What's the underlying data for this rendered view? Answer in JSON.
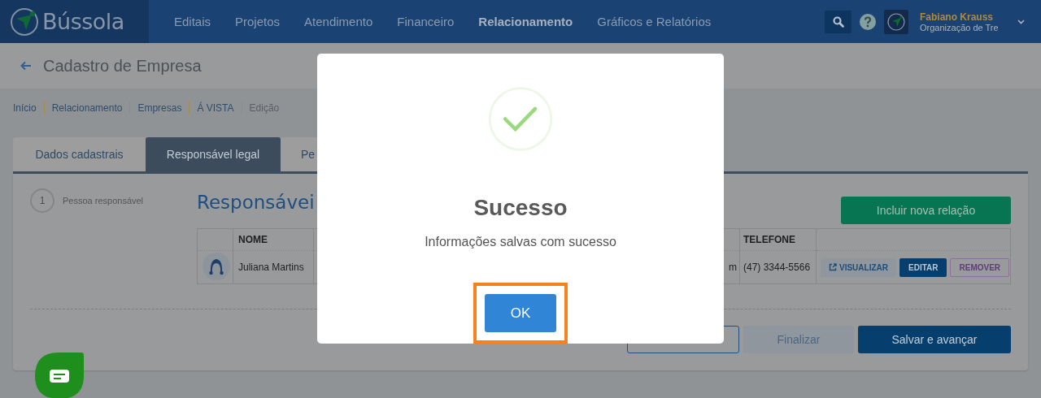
{
  "header": {
    "logo": "Bússola",
    "nav": [
      {
        "label": "Editais",
        "selected": false
      },
      {
        "label": "Projetos",
        "selected": false
      },
      {
        "label": "Atendimento",
        "selected": false
      },
      {
        "label": "Financeiro",
        "selected": false
      },
      {
        "label": "Relacionamento",
        "selected": true
      },
      {
        "label": "Gráficos e Relatórios",
        "selected": false
      }
    ],
    "user": {
      "name": "Fabiano Krauss",
      "organization": "Organização de Tre"
    }
  },
  "page": {
    "title": "Cadastro de Empresa",
    "breadcrumb": [
      {
        "label": "Início",
        "current": false
      },
      {
        "label": "Relacionamento",
        "current": false
      },
      {
        "label": "Empresas",
        "current": false
      },
      {
        "label": "Á VISTA",
        "current": false
      },
      {
        "label": "Edição",
        "current": true
      }
    ]
  },
  "tabs": [
    {
      "label": "Dados cadastrais",
      "selected": false
    },
    {
      "label": "Responsável legal",
      "selected": true
    },
    {
      "label": "Pe",
      "selected": false
    }
  ],
  "steps": [
    {
      "number": "1",
      "label": "Pessoa responsável"
    }
  ],
  "section": {
    "heading": "Responsávei",
    "add_button": "Incluir nova relação"
  },
  "table": {
    "columns": {
      "name": "NOME",
      "phone": "TELEFONE"
    },
    "rows": [
      {
        "name": "Juliana Martins",
        "column_3": "m",
        "phone": "(47) 3344-5566",
        "actions": [
          {
            "kind": "view",
            "label": "VISUALIZAR"
          },
          {
            "kind": "edit",
            "label": "EDITAR"
          },
          {
            "kind": "remove",
            "label": "REMOVER"
          }
        ]
      }
    ]
  },
  "footer_buttons": [
    {
      "kind": "outline"
    },
    {
      "kind": "disabled",
      "label": "Finalizar"
    },
    {
      "kind": "primary",
      "label": "Salvar e avançar"
    }
  ],
  "modal": {
    "title": "Sucesso",
    "message": "Informações salvas com sucesso",
    "button": "OK",
    "button_highlighted": true
  }
}
